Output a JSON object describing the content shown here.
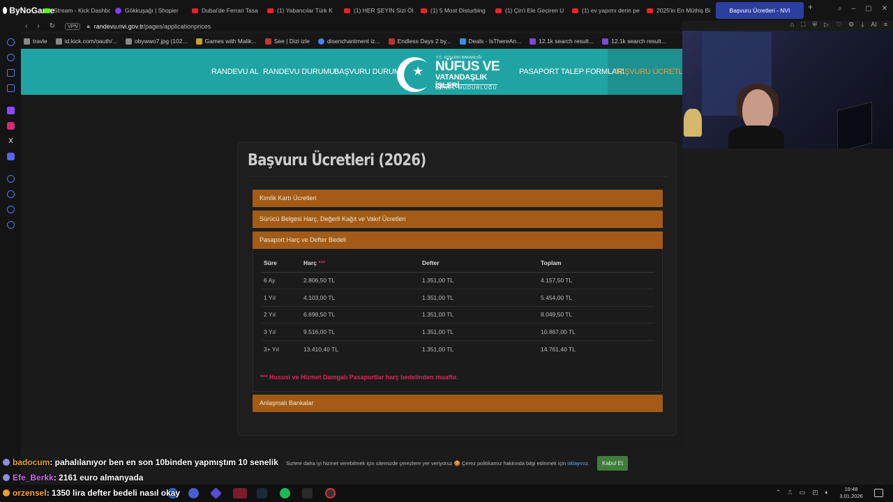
{
  "brand": {
    "name": "ByNoGame"
  },
  "tabs": [
    {
      "label": "Stream - Kick Dashbo",
      "icon": "kick-icon"
    },
    {
      "label": "Gökkuşağı | Shopier",
      "icon": "shopier-icon"
    },
    {
      "label": "Dubai'de Ferrari Tasa",
      "icon": "youtube-icon"
    },
    {
      "label": "(1) Yabancılar Türk K",
      "icon": "youtube-icon"
    },
    {
      "label": "(1) HER ŞEYİN Sizi Öl",
      "icon": "youtube-icon"
    },
    {
      "label": "(1) 5 Most Disturbing",
      "icon": "youtube-icon"
    },
    {
      "label": "(1) Çin'i Ele Geçiren U",
      "icon": "youtube-icon"
    },
    {
      "label": "(1) ev yapımı derin pe",
      "icon": "youtube-icon"
    },
    {
      "label": "2025'in En Müthiş Bi",
      "icon": "youtube-icon"
    },
    {
      "label": "Başvuru Ücretleri - NVI",
      "icon": "nvi-icon",
      "active": true
    }
  ],
  "address": {
    "vpn": "VPN",
    "url_host": "randevu.nvi.gov.tr",
    "url_path": "/pages/applicationprices"
  },
  "toolbar": {
    "ai_label": "AI"
  },
  "bookmarks": [
    {
      "label": "travle"
    },
    {
      "label": "id.kick.com/oauth/..."
    },
    {
      "label": "obywwo7.jpg (102..."
    },
    {
      "label": "Games with Malik..."
    },
    {
      "label": "See | Dizi izle"
    },
    {
      "label": "disenchantment iz..."
    },
    {
      "label": "Endless Days 2 by..."
    },
    {
      "label": "Deals - IsThereAn..."
    },
    {
      "label": "12.1k search result..."
    },
    {
      "label": "12.1k search result..."
    }
  ],
  "site": {
    "nav": [
      {
        "label": "RANDEVU AL"
      },
      {
        "label": "RANDEVU DURUMU"
      },
      {
        "label": "BAŞVURU DURUMU"
      },
      {
        "label": "PASAPORT TALEP FORMLARI"
      },
      {
        "label": "BAŞVURU ÜCRETLERİ",
        "active": true
      }
    ],
    "logo": {
      "small": "T.C. İÇİŞLERİ BAKANLIĞI",
      "line1": "NÜFUS VE",
      "line2": "VATANDAŞLIK İŞLERİ",
      "line3": "GENEL MÜDÜRLÜĞÜ"
    }
  },
  "page": {
    "title": "Başvuru Ücretleri (2026)",
    "accordions": [
      {
        "label": "Kimlik Kartı Ücretleri"
      },
      {
        "label": "Sürücü Belgesi Harç, Değerli Kağıt ve Vakıf Ücretleri"
      },
      {
        "label": "Pasaport Harç ve Defter Bedeli",
        "expanded": true
      },
      {
        "label": "Anlaşmalı Bankalar"
      }
    ],
    "table": {
      "headers": {
        "sure": "Süre",
        "harc": "Harç",
        "harc_mark": "***",
        "defter": "Defter",
        "toplam": "Toplam"
      },
      "rows": [
        {
          "sure": "6 Ay",
          "harc": "2.806,50 TL",
          "defter": "1.351,00 TL",
          "toplam": "4.157,50 TL"
        },
        {
          "sure": "1 Yıl",
          "harc": "4.103,00 TL",
          "defter": "1.351,00 TL",
          "toplam": "5.454,00 TL"
        },
        {
          "sure": "2 Yıl",
          "harc": "6.698,50 TL",
          "defter": "1.351,00 TL",
          "toplam": "8.049,50 TL"
        },
        {
          "sure": "3 Yıl",
          "harc": "9.516,00 TL",
          "defter": "1.351,00 TL",
          "toplam": "10.867,00 TL"
        },
        {
          "sure": "3+ Yıl",
          "harc": "13.410,40 TL",
          "defter": "1.351,00 TL",
          "toplam": "14.761,40 TL"
        }
      ]
    },
    "note_mark": "***",
    "note": "Hususi ve Hizmet Damgalı Pasaportlar harç bedelinden muaftır."
  },
  "cookie": {
    "text": "Sizlere daha iyi hizmet verebilmek için sitemizde çerezlere yer veriyoruz 🍪 Çerez politikamız hakkında bilgi edinmek için",
    "link": "tıklayınız.",
    "button": "Kabul Et"
  },
  "chat": [
    {
      "user": "badocum",
      "message": ": pahalılanıyor ben en son 10binden yapmıştım 10 senelik"
    },
    {
      "user": "Efe_Berkk",
      "message": ": 2161 euro almanyada"
    },
    {
      "user": "orzensel",
      "message": ": 1350 lira defter bedeli nasıl okay"
    }
  ],
  "taskbar": {
    "time": "19:48",
    "date": "3.01.2026"
  },
  "colors": {
    "header_teal": "#20a4a3",
    "accordion_orange": "#a35b17",
    "active_nav": "#e4a23a",
    "note_red": "#e0245e",
    "cookie_button": "#3f7d3a"
  }
}
